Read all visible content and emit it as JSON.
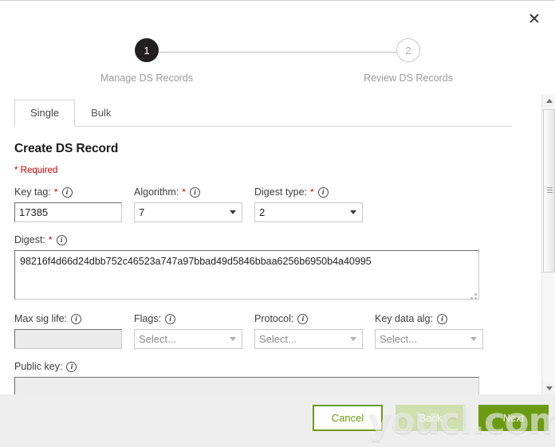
{
  "dialog": {
    "close_label": "✕"
  },
  "stepper": {
    "steps": [
      {
        "number": "1",
        "label": "Manage DS Records",
        "state": "active"
      },
      {
        "number": "2",
        "label": "Review DS Records",
        "state": "inactive"
      }
    ]
  },
  "tabs": [
    {
      "label": "Single",
      "active": true
    },
    {
      "label": "Bulk",
      "active": false
    }
  ],
  "form": {
    "title": "Create DS Record",
    "required_note": "* Required",
    "info_glyph": "i",
    "asterisk": "*",
    "fields": {
      "key_tag": {
        "label": "Key tag:",
        "value": "17385",
        "required": true
      },
      "algorithm": {
        "label": "Algorithm:",
        "value": "7",
        "required": true,
        "options": [
          "7"
        ]
      },
      "digest_type": {
        "label": "Digest type:",
        "value": "2",
        "required": true,
        "options": [
          "2"
        ]
      },
      "digest": {
        "label": "Digest:",
        "value": "98216f4d66d24dbb752c46523a747a97bbad49d5846bbaa6256b6950b4a40995",
        "required": true
      },
      "max_sig_life": {
        "label": "Max sig life:",
        "value": "",
        "required": false,
        "disabled": true
      },
      "flags": {
        "label": "Flags:",
        "value": "Select...",
        "required": false,
        "options": [
          "Select..."
        ]
      },
      "protocol": {
        "label": "Protocol:",
        "value": "Select...",
        "required": false,
        "options": [
          "Select..."
        ]
      },
      "key_data_alg": {
        "label": "Key data alg:",
        "value": "Select...",
        "required": false,
        "options": [
          "Select..."
        ]
      },
      "public_key": {
        "label": "Public key:",
        "value": "",
        "required": false,
        "disabled": true
      }
    }
  },
  "footer": {
    "cancel_label": "Cancel",
    "back_label": "Back",
    "next_label": "Next"
  },
  "watermark": {
    "text": "youcl.com"
  },
  "colors": {
    "accent_green": "#6b9b12",
    "back_disabled_green": "#cfdfae",
    "required_red": "#cc0000",
    "step_active": "#231f20",
    "footer_bg": "#eeeeee"
  }
}
